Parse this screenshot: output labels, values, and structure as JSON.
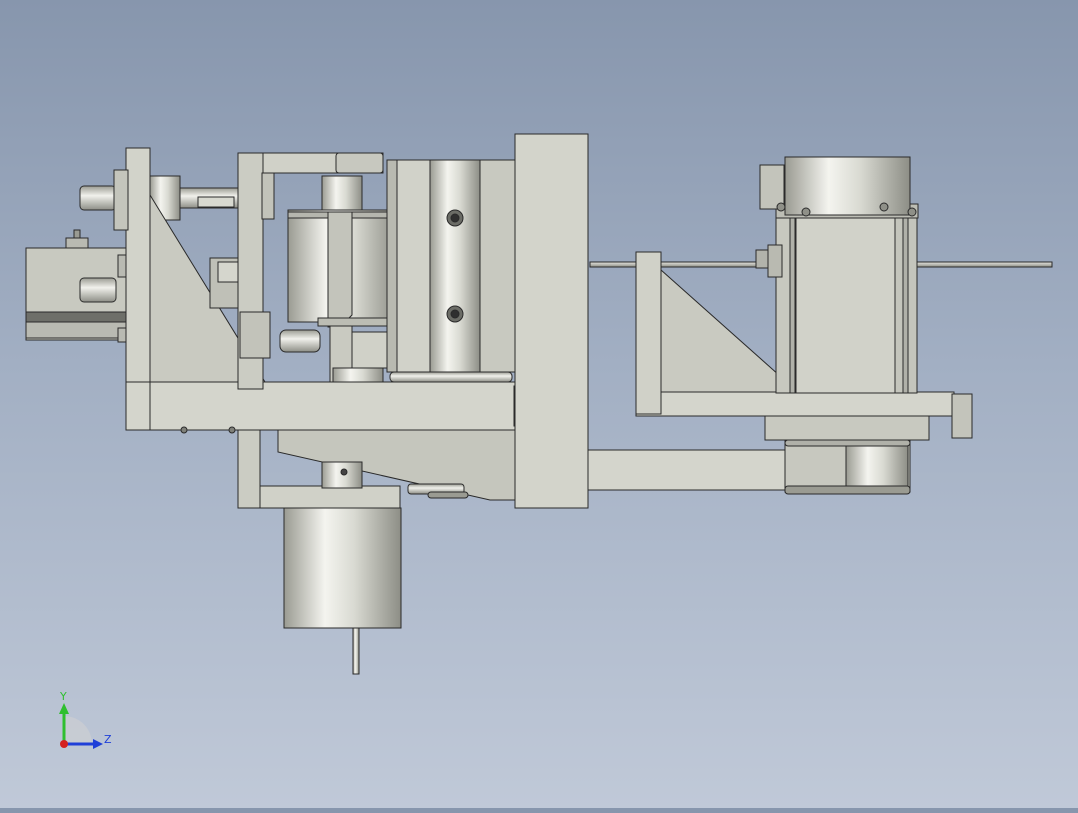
{
  "viewport": {
    "background_top": "#8796ad",
    "background_bottom": "#c0c9d8"
  },
  "model": {
    "part_fill": "#cfd0c6",
    "part_edge": "#2a2a2a",
    "cylinder_light": "#f4f4ef",
    "cylinder_dark": "#8d8e86"
  },
  "triad": {
    "y_label": "Y",
    "z_label": "Z",
    "y_color": "#2fbf2f",
    "z_color": "#1f3fd8",
    "x_color": "#d42020"
  }
}
